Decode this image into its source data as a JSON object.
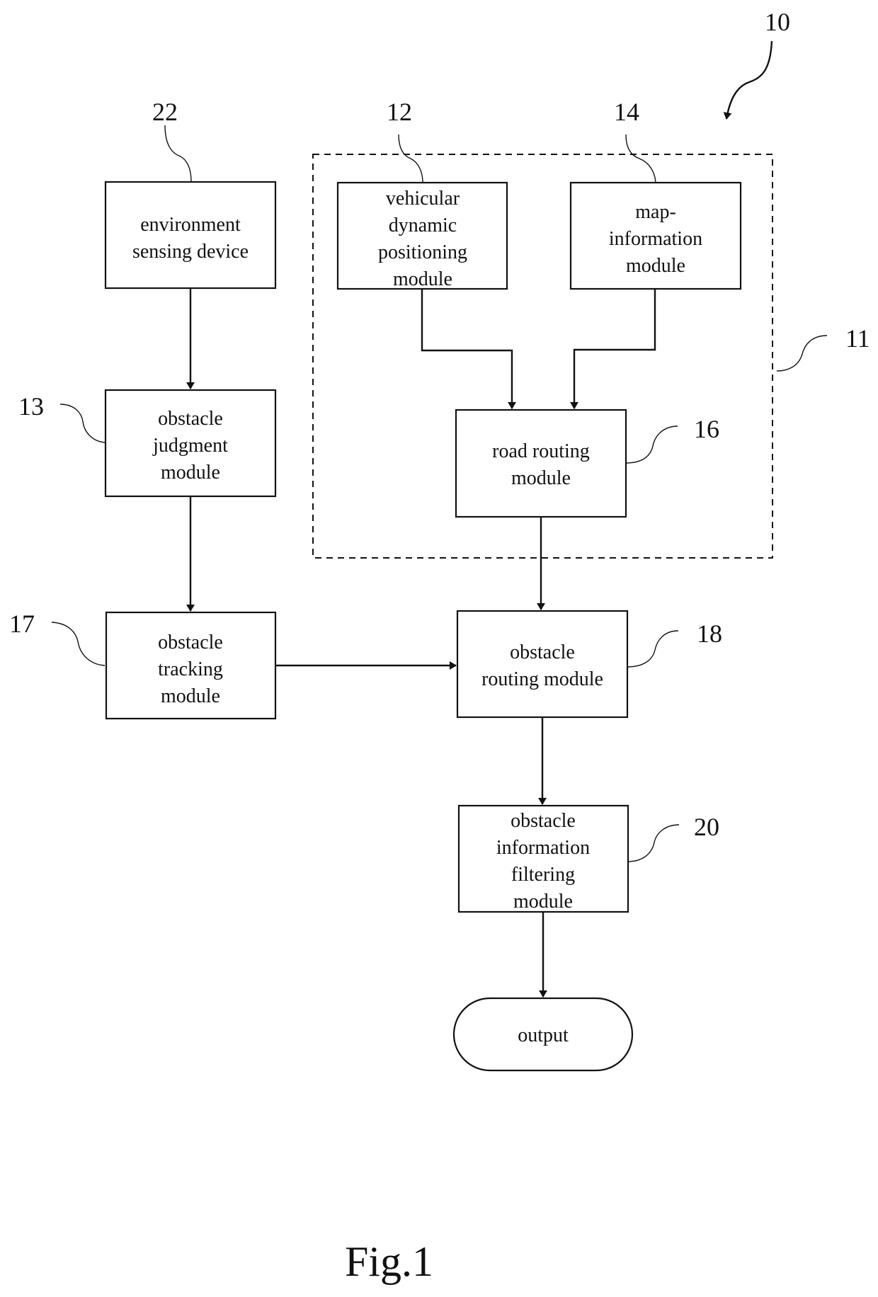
{
  "figure": {
    "caption": "Fig.1",
    "system_ref": "10",
    "group": {
      "ref": "11",
      "name": "dashed-group"
    }
  },
  "modules": [
    {
      "id": "env",
      "ref": "22",
      "lines": [
        "environment",
        "sensing device"
      ]
    },
    {
      "id": "judgment",
      "ref": "13",
      "lines": [
        "obstacle",
        "judgment",
        "module"
      ]
    },
    {
      "id": "tracking",
      "ref": "17",
      "lines": [
        "obstacle",
        "tracking",
        "module"
      ]
    },
    {
      "id": "vehicular",
      "ref": "12",
      "lines": [
        "vehicular",
        "dynamic",
        "positioning",
        "module"
      ]
    },
    {
      "id": "map",
      "ref": "14",
      "lines": [
        "map-",
        "information",
        "module"
      ]
    },
    {
      "id": "road",
      "ref": "16",
      "lines": [
        "road routing",
        "module"
      ]
    },
    {
      "id": "obsrouting",
      "ref": "18",
      "lines": [
        "obstacle",
        "routing module"
      ]
    },
    {
      "id": "filtering",
      "ref": "20",
      "lines": [
        "obstacle",
        "information",
        "filtering",
        "module"
      ]
    },
    {
      "id": "output",
      "ref": "",
      "lines": [
        "output"
      ]
    }
  ],
  "connections": [
    {
      "from": "env",
      "to": "judgment"
    },
    {
      "from": "judgment",
      "to": "tracking"
    },
    {
      "from": "vehicular",
      "to": "road"
    },
    {
      "from": "map",
      "to": "road"
    },
    {
      "from": "road",
      "to": "obsrouting"
    },
    {
      "from": "tracking",
      "to": "obsrouting"
    },
    {
      "from": "obsrouting",
      "to": "filtering"
    },
    {
      "from": "filtering",
      "to": "output"
    }
  ]
}
